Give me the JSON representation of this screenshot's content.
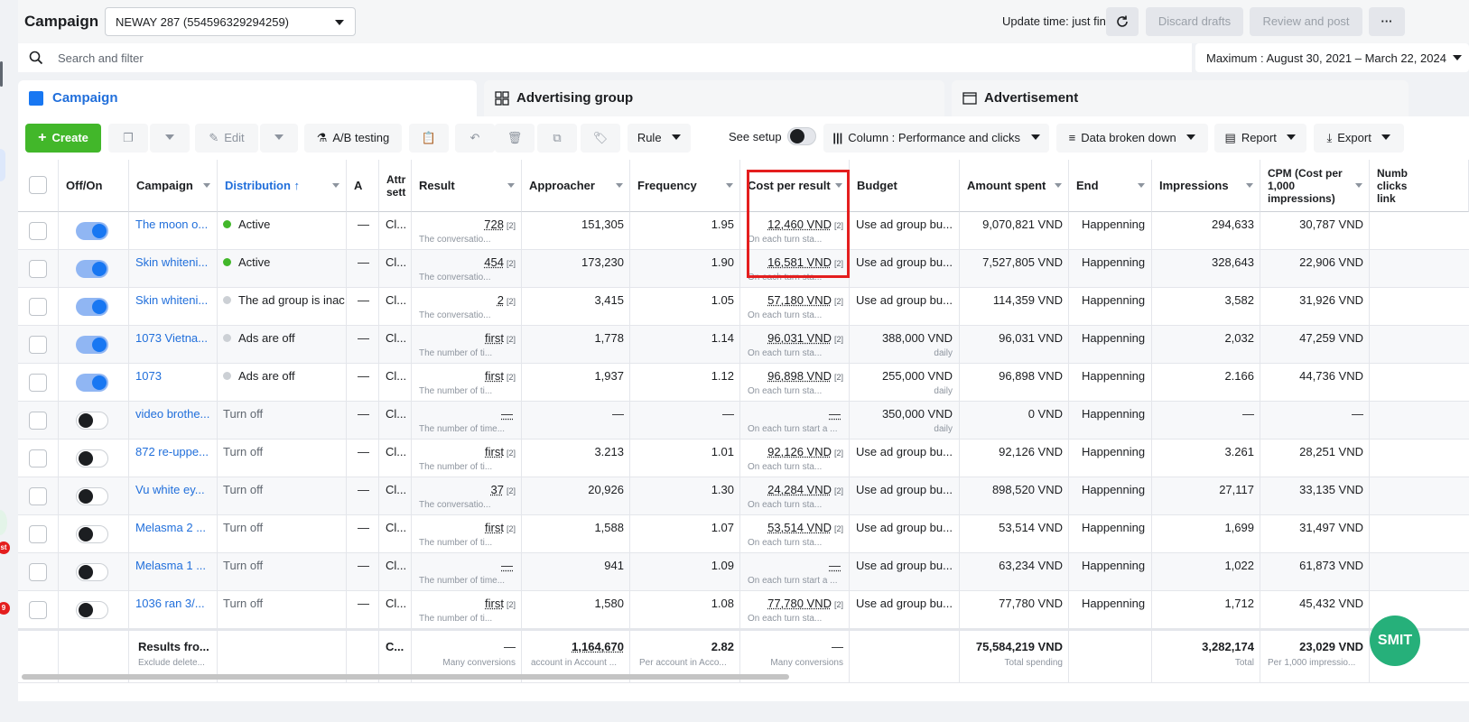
{
  "header": {
    "title": "Campaign",
    "account": "NEWAY 287 (554596329294259)",
    "update_time": "Update time: just finished",
    "discard": "Discard drafts",
    "review": "Review and post",
    "more": "···"
  },
  "search": {
    "placeholder": "Search and filter",
    "date_range": "Maximum : August 30, 2021 – March 22, 2024"
  },
  "tabs": [
    {
      "label": "Campaign"
    },
    {
      "label": "Advertising group"
    },
    {
      "label": "Advertisement"
    }
  ],
  "toolbar": {
    "create": "Create",
    "edit": "Edit",
    "ab": "A/B testing",
    "rule": "Rule",
    "see_setup": "See setup",
    "column": "Column : Performance and clicks",
    "breakdown": "Data broken down",
    "report": "Report",
    "export": "Export"
  },
  "columns": {
    "offon": "Off/On",
    "campaign": "Campaign",
    "distribution": "Distribution ↑",
    "a": "A",
    "attr": "Attr sett",
    "result": "Result",
    "approacher": "Approacher",
    "frequency": "Frequency",
    "cpr": "Cost per result",
    "budget": "Budget",
    "spent": "Amount spent",
    "end": "End",
    "impressions": "Impressions",
    "cpm": "CPM (Cost per 1,000 impressions)",
    "clicks": "Numb clicks link"
  },
  "rows": [
    {
      "on": true,
      "name": "The moon o...",
      "status": "Active",
      "status_color": "#42b72a",
      "dash": "—",
      "attr": "Cl...",
      "result": "728",
      "result_ref": "[2]",
      "result_sub": "The conversatio...",
      "approacher": "151,305",
      "frequency": "1.95",
      "cpr": "12,460 VND",
      "cpr_ref": "[2]",
      "cpr_sub": "On each turn sta...",
      "budget": "Use ad group bu...",
      "budget_sub": "",
      "spent": "9,070,821 VND",
      "end": "Happenning",
      "impressions": "294,633",
      "cpm": "30,787 VND"
    },
    {
      "on": true,
      "name": "Skin whiteni...",
      "status": "Active",
      "status_color": "#42b72a",
      "dash": "—",
      "attr": "Cl...",
      "result": "454",
      "result_ref": "[2]",
      "result_sub": "The conversatio...",
      "approacher": "173,230",
      "frequency": "1.90",
      "cpr": "16,581 VND",
      "cpr_ref": "[2]",
      "cpr_sub": "On each turn sta...",
      "budget": "Use ad group bu...",
      "budget_sub": "",
      "spent": "7,527,805 VND",
      "end": "Happenning",
      "impressions": "328,643",
      "cpm": "22,906 VND"
    },
    {
      "on": true,
      "name": "Skin whiteni...",
      "status": "The ad group is inac",
      "status_color": "#ccd0d5",
      "dash": "—",
      "attr": "Cl...",
      "result": "2",
      "result_ref": "[2]",
      "result_sub": "The conversatio...",
      "approacher": "3,415",
      "frequency": "1.05",
      "cpr": "57,180 VND",
      "cpr_ref": "[2]",
      "cpr_sub": "On each turn sta...",
      "budget": "Use ad group bu...",
      "budget_sub": "",
      "spent": "114,359 VND",
      "end": "Happenning",
      "impressions": "3,582",
      "cpm": "31,926 VND"
    },
    {
      "on": true,
      "name": "1073 Vietna...",
      "status": "Ads are off",
      "status_color": "#ccd0d5",
      "dash": "—",
      "attr": "Cl...",
      "result": "first",
      "result_ref": "[2]",
      "result_sub": "The number of ti...",
      "approacher": "1,778",
      "frequency": "1.14",
      "cpr": "96,031 VND",
      "cpr_ref": "[2]",
      "cpr_sub": "On each turn sta...",
      "budget": "388,000 VND",
      "budget_sub": "daily",
      "spent": "96,031 VND",
      "end": "Happenning",
      "impressions": "2,032",
      "cpm": "47,259 VND"
    },
    {
      "on": true,
      "name": "1073",
      "status": "Ads are off",
      "status_color": "#ccd0d5",
      "dash": "—",
      "attr": "Cl...",
      "result": "first",
      "result_ref": "[2]",
      "result_sub": "The number of ti...",
      "approacher": "1,937",
      "frequency": "1.12",
      "cpr": "96,898 VND",
      "cpr_ref": "[2]",
      "cpr_sub": "On each turn sta...",
      "budget": "255,000 VND",
      "budget_sub": "daily",
      "spent": "96,898 VND",
      "end": "Happenning",
      "impressions": "2.166",
      "cpm": "44,736 VND"
    },
    {
      "on": false,
      "name": "video brothe...",
      "status": "Turn off",
      "status_color": "",
      "dash": "—",
      "attr": "Cl...",
      "result": "—",
      "result_ref": "",
      "result_sub": "The number of time...",
      "approacher": "—",
      "frequency": "—",
      "cpr": "—",
      "cpr_ref": "",
      "cpr_sub": "On each turn start a ...",
      "budget": "350,000 VND",
      "budget_sub": "daily",
      "spent": "0 VND",
      "end": "Happenning",
      "impressions": "—",
      "cpm": "—"
    },
    {
      "on": false,
      "name": "872 re-uppe...",
      "status": "Turn off",
      "status_color": "",
      "dash": "—",
      "attr": "Cl...",
      "result": "first",
      "result_ref": "[2]",
      "result_sub": "The number of ti...",
      "approacher": "3.213",
      "frequency": "1.01",
      "cpr": "92,126 VND",
      "cpr_ref": "[2]",
      "cpr_sub": "On each turn sta...",
      "budget": "Use ad group bu...",
      "budget_sub": "",
      "spent": "92,126 VND",
      "end": "Happenning",
      "impressions": "3.261",
      "cpm": "28,251 VND"
    },
    {
      "on": false,
      "name": "Vu white ey...",
      "status": "Turn off",
      "status_color": "",
      "dash": "—",
      "attr": "Cl...",
      "result": "37",
      "result_ref": "[2]",
      "result_sub": "The conversatio...",
      "approacher": "20,926",
      "frequency": "1.30",
      "cpr": "24,284 VND",
      "cpr_ref": "[2]",
      "cpr_sub": "On each turn sta...",
      "budget": "Use ad group bu...",
      "budget_sub": "",
      "spent": "898,520 VND",
      "end": "Happenning",
      "impressions": "27,117",
      "cpm": "33,135 VND"
    },
    {
      "on": false,
      "name": "Melasma 2 ...",
      "status": "Turn off",
      "status_color": "",
      "dash": "—",
      "attr": "Cl...",
      "result": "first",
      "result_ref": "[2]",
      "result_sub": "The number of ti...",
      "approacher": "1,588",
      "frequency": "1.07",
      "cpr": "53,514 VND",
      "cpr_ref": "[2]",
      "cpr_sub": "On each turn sta...",
      "budget": "Use ad group bu...",
      "budget_sub": "",
      "spent": "53,514 VND",
      "end": "Happenning",
      "impressions": "1,699",
      "cpm": "31,497 VND"
    },
    {
      "on": false,
      "name": "Melasma 1 ...",
      "status": "Turn off",
      "status_color": "",
      "dash": "—",
      "attr": "Cl...",
      "result": "—",
      "result_ref": "",
      "result_sub": "The number of time...",
      "approacher": "941",
      "frequency": "1.09",
      "cpr": "—",
      "cpr_ref": "",
      "cpr_sub": "On each turn start a ...",
      "budget": "Use ad group bu...",
      "budget_sub": "",
      "spent": "63,234 VND",
      "end": "Happenning",
      "impressions": "1,022",
      "cpm": "61,873 VND"
    },
    {
      "on": false,
      "name": "1036 ran 3/...",
      "status": "Turn off",
      "status_color": "",
      "dash": "—",
      "attr": "Cl...",
      "result": "first",
      "result_ref": "[2]",
      "result_sub": "The number of ti...",
      "approacher": "1,580",
      "frequency": "1.08",
      "cpr": "77,780 VND",
      "cpr_ref": "[2]",
      "cpr_sub": "On each turn sta...",
      "budget": "Use ad group bu...",
      "budget_sub": "",
      "spent": "77,780 VND",
      "end": "Happenning",
      "impressions": "1,712",
      "cpm": "45,432 VND"
    }
  ],
  "totals": {
    "label": "Results fro...",
    "label_sub": "Exclude delete...",
    "attr": "C...",
    "result": "—",
    "result_sub": "Many conversions",
    "approacher": "1,164,670",
    "approacher_sub": "account in Account ...",
    "frequency": "2.82",
    "frequency_sub": "Per account in Acco...",
    "cpr": "—",
    "cpr_sub": "Many conversions",
    "spent": "75,584,219 VND",
    "spent_sub": "Total spending",
    "impressions": "3,282,174",
    "impressions_sub": "Total",
    "cpm": "23,029 VND",
    "cpm_sub": "Per 1,000 impressio..."
  },
  "widget": {
    "label": "SMIT"
  },
  "left_badges": [
    "st",
    "9"
  ]
}
